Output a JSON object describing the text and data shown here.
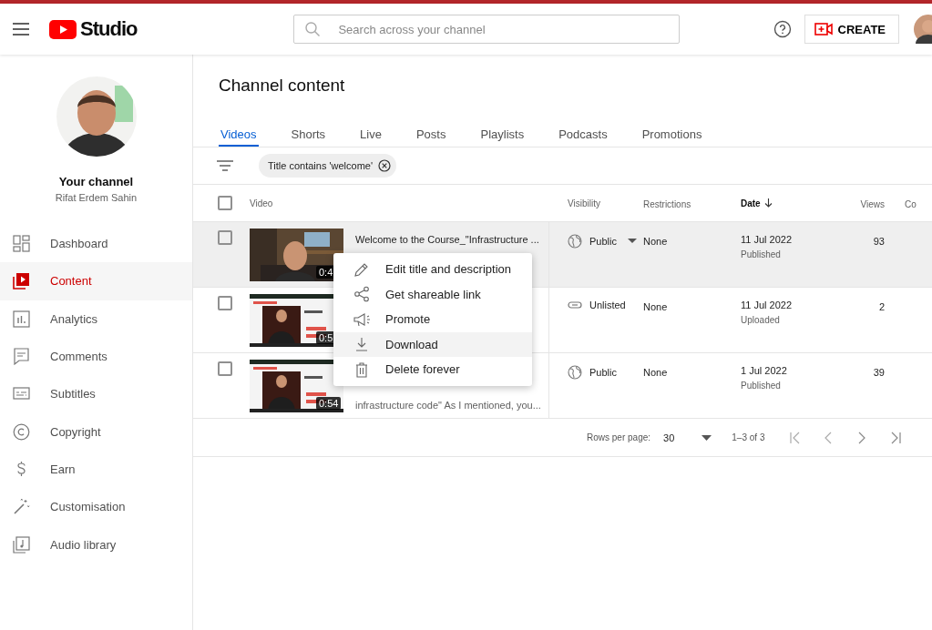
{
  "header": {
    "logo_text": "Studio",
    "search": {
      "placeholder": "Search across your channel"
    },
    "create_button": "CREATE"
  },
  "sidebar": {
    "channel_title": "Your channel",
    "channel_name": "Rifat Erdem Sahin",
    "items": [
      {
        "label": "Dashboard",
        "kind": "dashboard",
        "selected": false
      },
      {
        "label": "Content",
        "kind": "content",
        "selected": true
      },
      {
        "label": "Analytics",
        "kind": "analytics",
        "selected": false
      },
      {
        "label": "Comments",
        "kind": "comments",
        "selected": false
      },
      {
        "label": "Subtitles",
        "kind": "subtitles",
        "selected": false
      },
      {
        "label": "Copyright",
        "kind": "copyright",
        "selected": false
      },
      {
        "label": "Earn",
        "kind": "earn",
        "selected": false
      },
      {
        "label": "Customisation",
        "kind": "customisation",
        "selected": false
      },
      {
        "label": "Audio library",
        "kind": "audio",
        "selected": false
      }
    ]
  },
  "page_title": "Channel content",
  "tabs": [
    {
      "label": "Videos",
      "selected": true
    },
    {
      "label": "Shorts",
      "selected": false
    },
    {
      "label": "Live",
      "selected": false
    },
    {
      "label": "Posts",
      "selected": false
    },
    {
      "label": "Playlists",
      "selected": false
    },
    {
      "label": "Podcasts",
      "selected": false
    },
    {
      "label": "Promotions",
      "selected": false
    }
  ],
  "filter_chip": "Title contains 'welcome'",
  "table": {
    "select_all_checked": false,
    "columns": [
      {
        "label": "Video",
        "sorted": false
      },
      {
        "label": "Visibility",
        "sorted": false
      },
      {
        "label": "Restrictions",
        "sorted": false
      },
      {
        "label": "Date",
        "sorted": true
      },
      {
        "label": "Views",
        "sorted": false
      },
      {
        "label": "Co",
        "sorted": false
      }
    ],
    "rows": [
      {
        "highlighted": true,
        "checked": false,
        "duration": "0:4",
        "title": "Welcome to the Course_\"Infrastructure ...",
        "visibility": {
          "kind": "public",
          "label": "Public",
          "dropdown": true
        },
        "restrictions": "None",
        "date": "11 Jul 2022",
        "date_status": "Published",
        "views": "93"
      },
      {
        "highlighted": false,
        "checked": false,
        "duration": "0:5",
        "visibility": {
          "kind": "unlisted",
          "label": "Unlisted",
          "dropdown": false
        },
        "restrictions": "None",
        "date": "11 Jul 2022",
        "date_status": "Uploaded",
        "views": "2"
      },
      {
        "highlighted": false,
        "checked": false,
        "duration": "0:54",
        "description": "infrastructure code\" As I mentioned, you...",
        "visibility": {
          "kind": "public",
          "label": "Public",
          "dropdown": false
        },
        "restrictions": "None",
        "date": "1 Jul 2022",
        "date_status": "Published",
        "views": "39"
      }
    ]
  },
  "pagination": {
    "rows_per_page_label": "Rows per page:",
    "rows_per_page": "30",
    "range": "1–3 of 3"
  },
  "context_menu": [
    {
      "label": "Edit title and description",
      "kind": "edit",
      "highlighted": false
    },
    {
      "label": "Get shareable link",
      "kind": "share",
      "highlighted": false
    },
    {
      "label": "Promote",
      "kind": "promote",
      "highlighted": false
    },
    {
      "label": "Download",
      "kind": "download",
      "highlighted": true
    },
    {
      "label": "Delete forever",
      "kind": "delete",
      "highlighted": false
    }
  ]
}
